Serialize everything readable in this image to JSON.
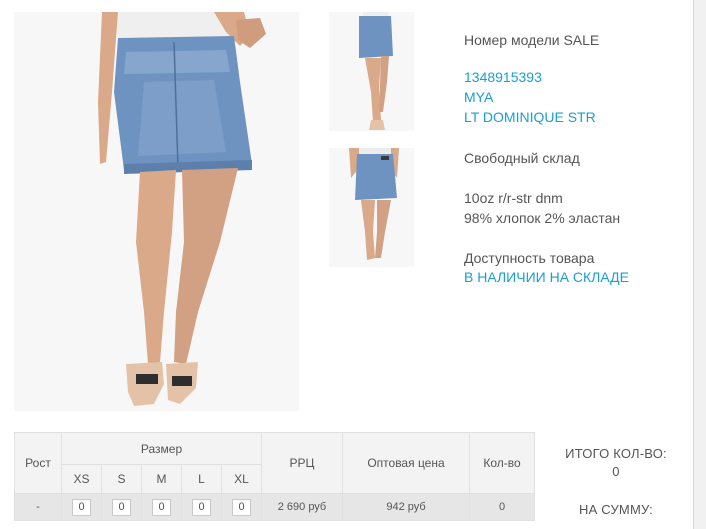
{
  "product": {
    "model_label": "Номер модели SALE",
    "sku": "1348915393",
    "brand": "MYA",
    "color": "LT DOMINIQUE STR",
    "warehouse": "Свободный склад",
    "fabric": "10oz r/r-str dnm",
    "composition": "98% хлопок 2% эластан",
    "availability_label": "Доступность товара",
    "availability_status": "В НАЛИЧИИ НА СКЛАДЕ"
  },
  "table": {
    "headers": {
      "height": "Рост",
      "size": "Размер",
      "rrp": "РРЦ",
      "wholesale": "Оптовая цена",
      "qty": "Кол-во"
    },
    "sizes": [
      "XS",
      "S",
      "M",
      "L",
      "XL"
    ],
    "row": {
      "height": "-",
      "quantities": [
        "0",
        "0",
        "0",
        "0",
        "0"
      ],
      "rrp": "2 690 руб",
      "wholesale": "942 руб",
      "qty": "0"
    }
  },
  "totals": {
    "count_label": "ИТОГО КОЛ-ВО:",
    "count_value": "0",
    "sum_label": "НА СУММУ:"
  },
  "colors": {
    "accent": "#1a9fd0",
    "denim": "#6f93c0",
    "skin": "#d9a989"
  }
}
